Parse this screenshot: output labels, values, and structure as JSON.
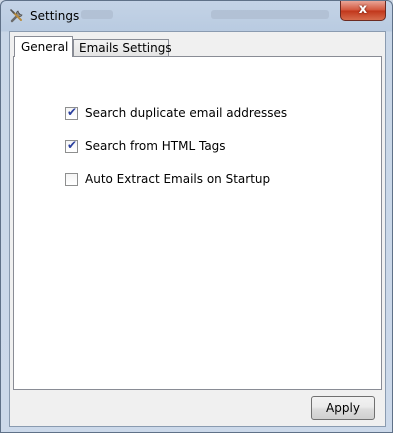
{
  "window": {
    "title": "Settings",
    "icon": "settings-tools-icon",
    "close_symbol": "x"
  },
  "tabs": [
    {
      "label": "General",
      "selected": true
    },
    {
      "label": "Emails Settings",
      "selected": false
    }
  ],
  "options": [
    {
      "label": "Search duplicate email addresses",
      "checked": true
    },
    {
      "label": "Search from HTML Tags",
      "checked": true
    },
    {
      "label": "Auto Extract Emails on Startup",
      "checked": false
    }
  ],
  "buttons": {
    "apply_label": "Apply"
  },
  "colors": {
    "close_button_red": "#c1361b",
    "check_mark_blue": "#2a3f9e",
    "title_bar_blue": "#b9cbe1"
  }
}
